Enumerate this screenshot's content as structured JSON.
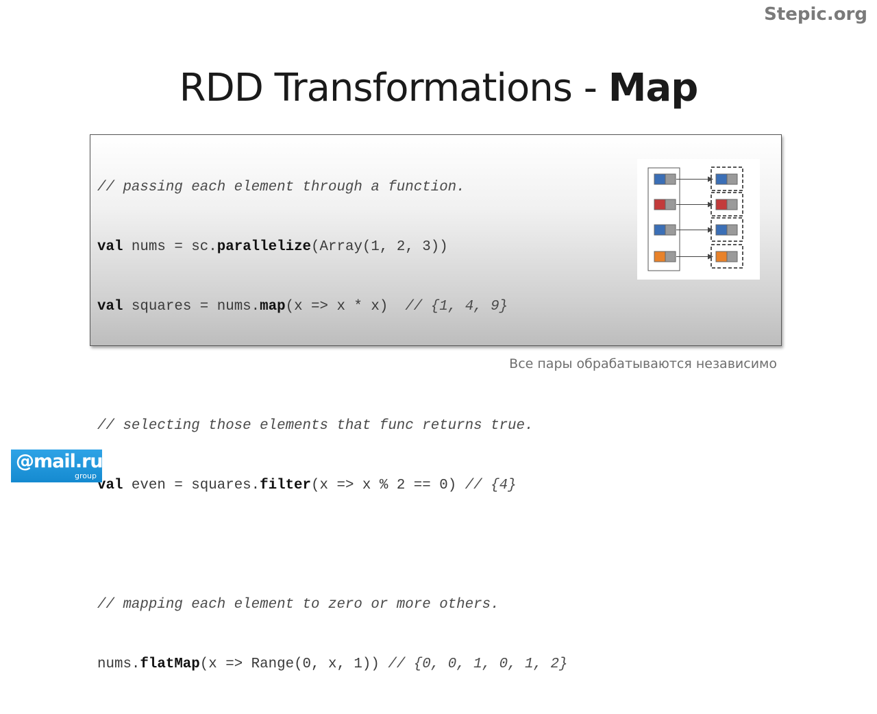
{
  "brand": "Stepic.org",
  "title": {
    "main": "RDD Transformations - ",
    "bold": "Map"
  },
  "code": {
    "l1": {
      "comment": "// passing each element through a function."
    },
    "l2": {
      "kw": "val",
      "a": " nums = sc.",
      "fn": "parallelize",
      "b": "(Array(1, 2, 3))"
    },
    "l3": {
      "kw": "val",
      "a": " squares = nums.",
      "fn": "map",
      "b": "(x => x * x)  ",
      "comment": "// {1, 4, 9}"
    },
    "l5": {
      "comment": "// selecting those elements that func returns true."
    },
    "l6": {
      "kw": "val",
      "a": " even = squares.",
      "fn": "filter",
      "b": "(x => x % 2 == 0) ",
      "comment": "// {4}"
    },
    "l8": {
      "comment": "// mapping each element to zero or more others."
    },
    "l9": {
      "a": "nums.",
      "fn": "flatMap",
      "b": "(x => Range(0, x, 1)) ",
      "comment": "// {0, 0, 1, 0, 1, 2}"
    }
  },
  "diagram": {
    "colors": [
      "#3b6fb6",
      "#c33b3b",
      "#3b6fb6",
      "#e8822a"
    ],
    "gray": "#9a9a9a"
  },
  "note": "Все пары обрабатываются независимо",
  "logo": {
    "main": "@mail.ru",
    "sub": "group"
  }
}
